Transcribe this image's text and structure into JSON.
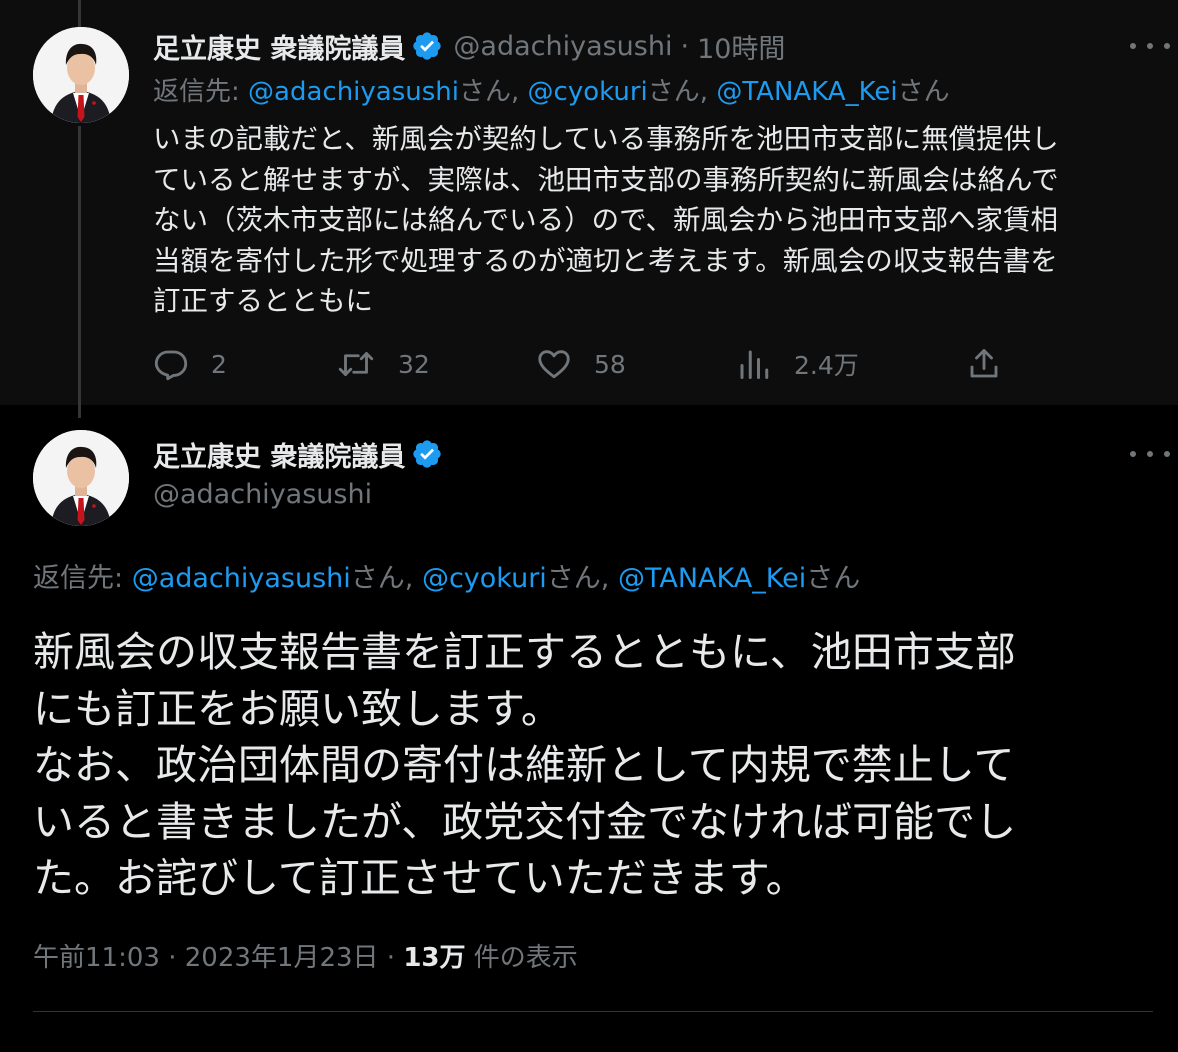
{
  "parent_tweet": {
    "author": {
      "display_name": "足立康史 衆議院議員",
      "handle": "@adachiyasushi",
      "verified": true
    },
    "separator": "·",
    "time_ago": "10時間",
    "reply_prefix": "返信先: ",
    "mentions": [
      {
        "handle": "@adachiyasushi",
        "suffix": "さん, "
      },
      {
        "handle": "@cyokuri",
        "suffix": "さん, "
      },
      {
        "handle": "@TANAKA_Kei",
        "suffix": "さん"
      }
    ],
    "text_lines": [
      "いまの記載だと、新風会が契約している事務所を池田市支部に無償提供し",
      "ていると解せますが、実際は、池田市支部の事務所契約に新風会は絡んで",
      "ない（茨木市支部には絡んでいる）ので、新風会から池田市支部へ家賃相",
      "当額を寄付した形で処理するのが適切と考えます。新風会の収支報告書を",
      "訂正するとともに"
    ],
    "stats": {
      "replies": "2",
      "retweets": "32",
      "likes": "58",
      "views": "2.4万"
    }
  },
  "main_tweet": {
    "author": {
      "display_name": "足立康史 衆議院議員",
      "handle": "@adachiyasushi",
      "verified": true
    },
    "reply_prefix": "返信先: ",
    "mentions": [
      {
        "handle": "@adachiyasushi",
        "suffix": "さん, "
      },
      {
        "handle": "@cyokuri",
        "suffix": "さん, "
      },
      {
        "handle": "@TANAKA_Kei",
        "suffix": "さん"
      }
    ],
    "text_lines": [
      "新風会の収支報告書を訂正するとともに、池田市支部",
      "にも訂正をお願い致します。",
      "なお、政治団体間の寄付は維新として内規で禁止して",
      "いると書きましたが、政党交付金でなければ可能でし",
      "た。お詫びして訂正させていただきます。"
    ],
    "time": "午前11:03",
    "date": "2023年1月23日",
    "separator": " · ",
    "view_count": "13万",
    "view_label": " 件の表示"
  },
  "colors": {
    "background": "#000000",
    "parent_background": "#0d0d0d",
    "text_primary": "#e7e9ea",
    "text_secondary": "#71767b",
    "link": "#1d9bf0",
    "verified_badge": "#1d9bf0",
    "divider": "#2f3336"
  },
  "icons": {
    "verified": "verified-badge-icon",
    "more": "more-dots-icon",
    "reply": "reply-bubble-icon",
    "retweet": "retweet-icon",
    "like": "heart-icon",
    "views": "views-bar-chart-icon",
    "share": "share-upload-icon"
  }
}
